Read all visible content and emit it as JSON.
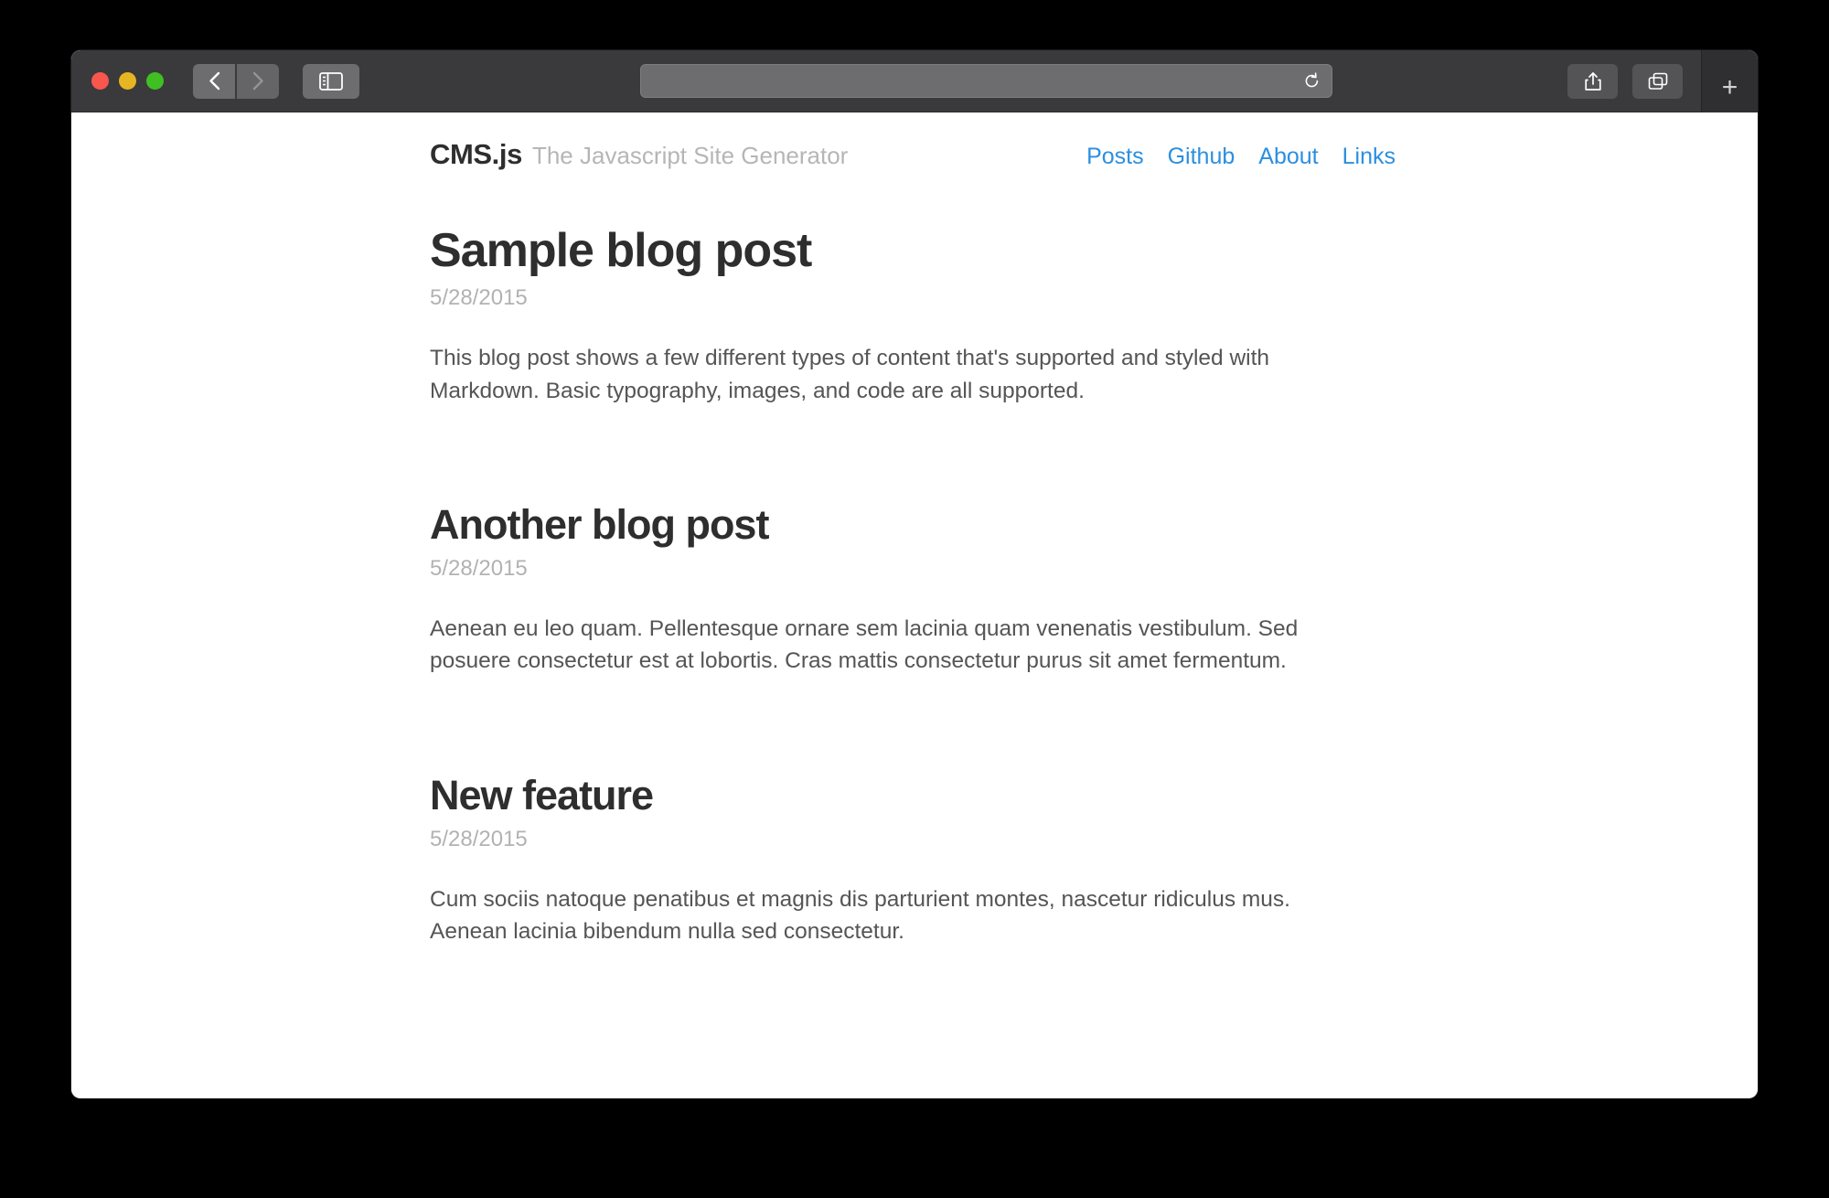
{
  "browser": {
    "traffic_lights": {
      "close_label": "close",
      "minimize_label": "minimize",
      "zoom_label": "zoom",
      "close_color": "#f9564d",
      "minimize_color": "#e6b522",
      "zoom_color": "#40bf22"
    },
    "back_icon": "back-chevron-icon",
    "forward_icon": "forward-chevron-icon",
    "sidebar_icon": "sidebar-toggle-icon",
    "address_value": "",
    "address_placeholder": "",
    "reload_icon": "reload-icon",
    "share_icon": "share-icon",
    "tabs_icon": "show-tabs-icon",
    "new_tab_label": "+"
  },
  "site": {
    "brand_name": "CMS.js",
    "brand_tagline": "The Javascript Site Generator",
    "nav": [
      {
        "label": "Posts"
      },
      {
        "label": "Github"
      },
      {
        "label": "About"
      },
      {
        "label": "Links"
      }
    ],
    "nav_color": "#2b8fe0"
  },
  "posts": [
    {
      "title": "Sample blog post",
      "date": "5/28/2015",
      "body": "This blog post shows a few different types of content that's supported and styled with Markdown. Basic typography, images, and code are all supported."
    },
    {
      "title": "Another blog post",
      "date": "5/28/2015",
      "body": "Aenean eu leo quam. Pellentesque ornare sem lacinia quam venenatis vestibulum. Sed posuere consectetur est at lobortis. Cras mattis consectetur purus sit amet fermentum."
    },
    {
      "title": "New feature",
      "date": "5/28/2015",
      "body": "Cum sociis natoque penatibus et magnis dis parturient montes, nascetur ridiculus mus. Aenean lacinia bibendum nulla sed consectetur."
    }
  ]
}
